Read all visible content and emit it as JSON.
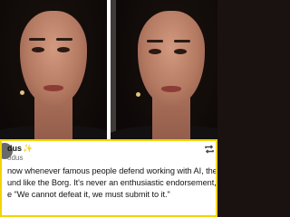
{
  "tweet": {
    "display_name": "dus",
    "badge_icon": "sparkle-icon",
    "handle": "odus",
    "lines": [
      "now whenever famous people defend working with AI, they",
      "und like the Borg. It's never an enthusiastic endorsement, it",
      "e \"We cannot defeat it, we must submit to it.\""
    ],
    "action_icon": "repost-icon"
  },
  "colors": {
    "border_accent": "#f2d400",
    "badge": "#f2a900",
    "divider": "#ffffff"
  }
}
